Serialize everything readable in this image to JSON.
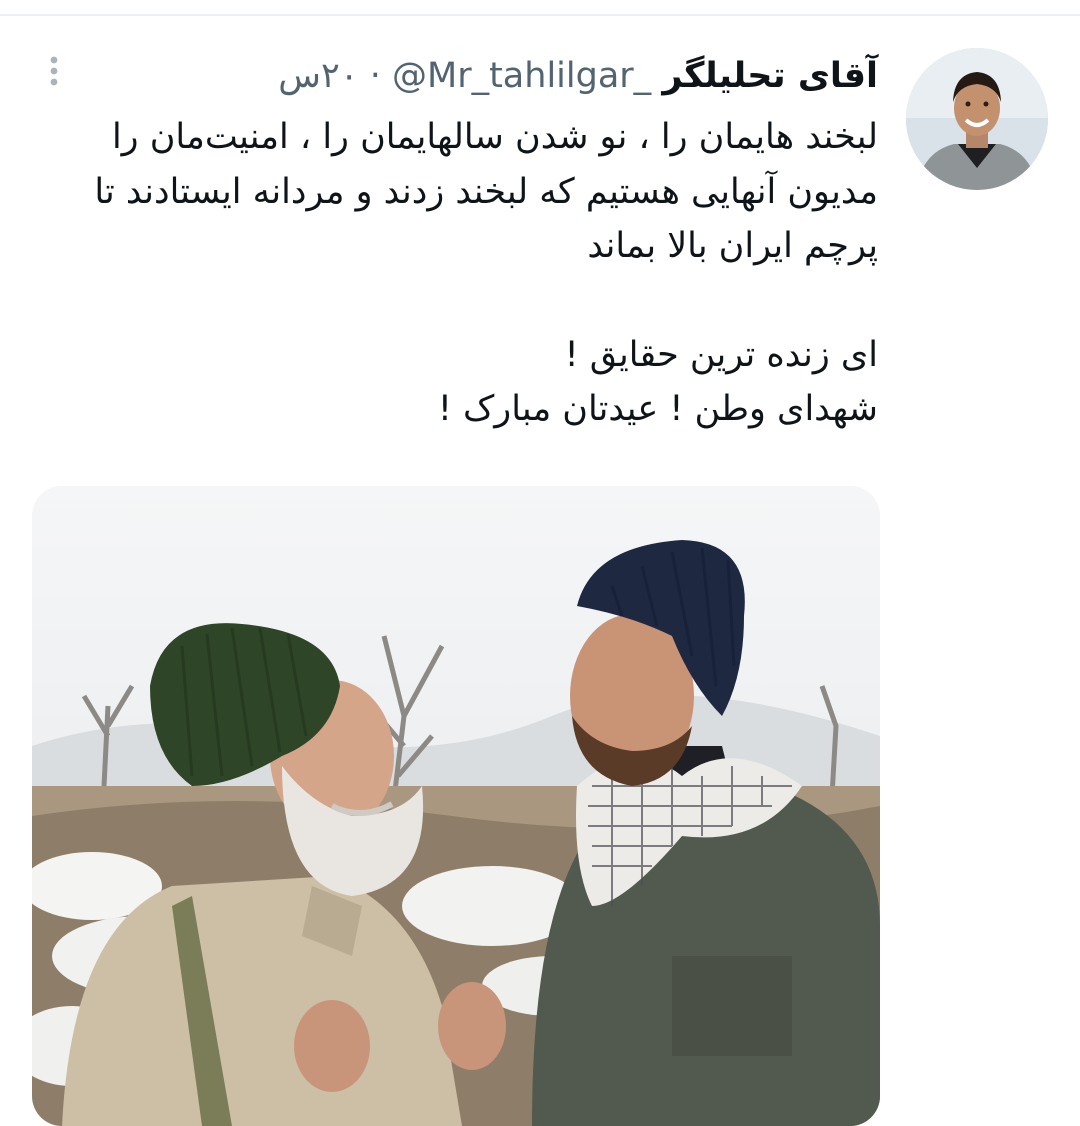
{
  "tweet": {
    "author_name": "آقای تحلیلگر",
    "author_handle": "@Mr_tahlilgar_",
    "separator": "·",
    "time_ago": "۲۰س",
    "text_paragraph_1": "لبخند هایمان را ، نو شدن سالهایمان را ، امنیت‌مان را مدیون آنهایی هستیم که لبخند زدند و مردانه ایستادند تا پرچم ایران بالا بماند",
    "text_line_2": "ای زنده ترین حقایق !",
    "text_line_3": "شهدای وطن ! عیدتان مبارک !"
  },
  "icons": {
    "more": "more-vertical-icon"
  },
  "colors": {
    "name_text": "#0f1419",
    "meta_text": "#536471",
    "divider": "#eceff1"
  }
}
